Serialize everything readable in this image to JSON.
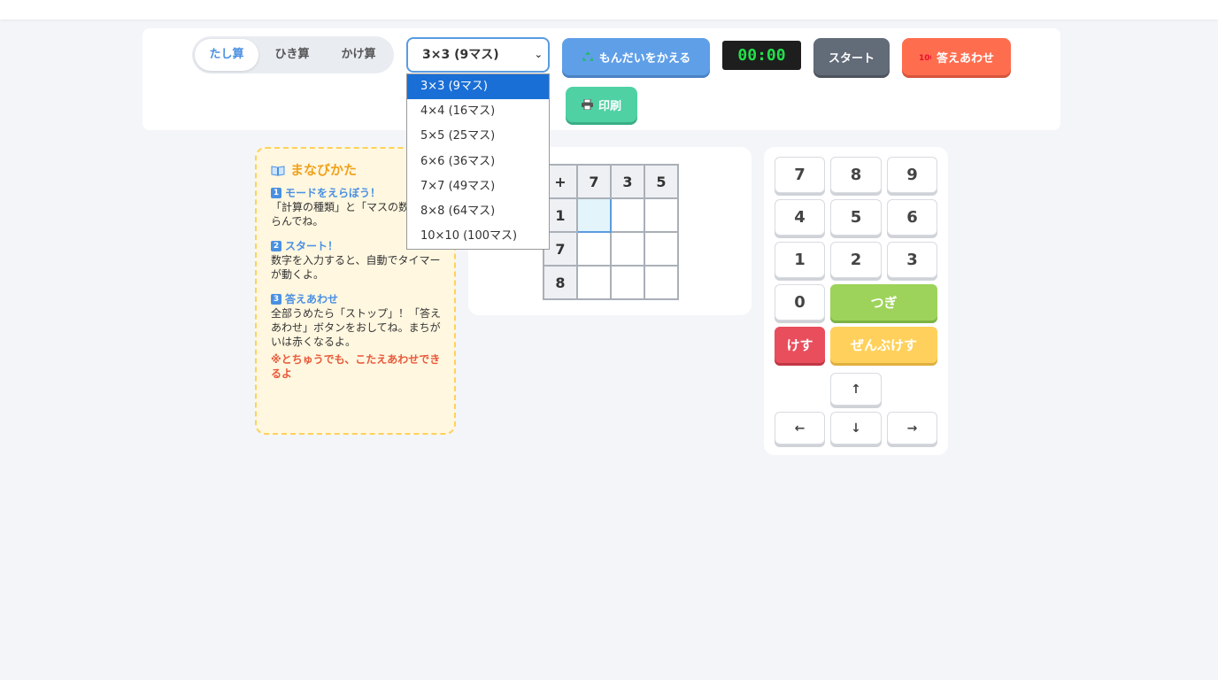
{
  "modes": [
    {
      "label": "たし算",
      "active": true
    },
    {
      "label": "ひき算",
      "active": false
    },
    {
      "label": "かけ算",
      "active": false
    }
  ],
  "size_select": {
    "value": "3×3 (9マス)",
    "options": [
      "3×3 (9マス)",
      "4×4 (16マス)",
      "5×5 (25マス)",
      "6×6 (36マス)",
      "7×7 (49マス)",
      "8×8 (64マス)",
      "10×10 (100マス)"
    ]
  },
  "toolbar": {
    "change_label": "もんだいをかえる",
    "timer": "00:00",
    "start_label": "スタート",
    "check_label": "答えあわせ",
    "print_label": "印刷"
  },
  "learn": {
    "title": "まなびかた",
    "steps": [
      {
        "num": "1",
        "title": "モードをえらぼう！",
        "text": "「計算の種類」と「マスの数」をえらんでね。"
      },
      {
        "num": "2",
        "title": "スタート！",
        "text": "数字を入力すると、自動でタイマーが動くよ。"
      },
      {
        "num": "3",
        "title": "答えあわせ",
        "text": "全部うめたら「ストップ」！「答えあわせ」ボタンをおしてね。まちがいは赤くなるよ。"
      }
    ],
    "note": "※とちゅうでも、こたえあわせできるよ"
  },
  "grid": {
    "operator": "+",
    "top": [
      "7",
      "3",
      "5"
    ],
    "left": [
      "1",
      "7",
      "8"
    ]
  },
  "keypad": {
    "digits": [
      "7",
      "8",
      "9",
      "4",
      "5",
      "6",
      "1",
      "2",
      "3",
      "0"
    ],
    "next_label": "つぎ",
    "delete_label": "けす",
    "clear_label": "ぜんぶけす",
    "arrows": {
      "up": "↑",
      "left": "←",
      "down": "↓",
      "right": "→"
    }
  },
  "colors": {
    "accent": "#4a90e2",
    "change": "#5f9fe8",
    "start": "#626b78",
    "check": "#ff6d4f",
    "print": "#4fd1a3",
    "timer_text": "#22e04a"
  }
}
